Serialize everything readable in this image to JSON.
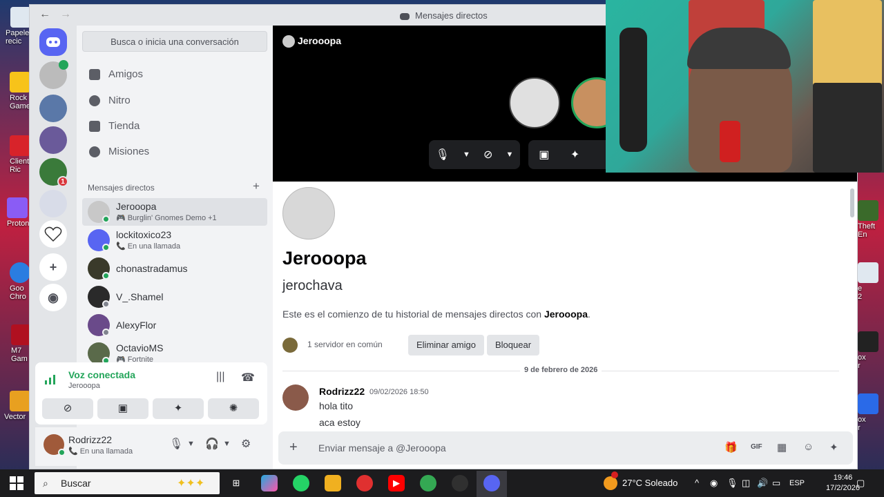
{
  "desktop": {
    "icons": [
      {
        "label": "Papele\nrecic",
        "color": "#dfe8f0"
      },
      {
        "label": "Rock\nGame",
        "color": "#f7c31a"
      },
      {
        "label": "Client\nRic",
        "color": "#d8232a"
      },
      {
        "label": "Proton",
        "color": "#8a5cf5"
      },
      {
        "label": "Goo\nChro",
        "color": "#2a7de1"
      },
      {
        "label": "M7\nGam",
        "color": "#b01020"
      },
      {
        "label": "Vector",
        "color": "#e8a020"
      }
    ],
    "right_icons": [
      "Theft\nEn",
      "e\n2",
      "ox\nr",
      "ox\nr"
    ]
  },
  "window": {
    "title": "Mensajes directos",
    "back": "←",
    "forward": "→"
  },
  "rail": {
    "badge": "1",
    "add_label": "+",
    "explore_label": "◉"
  },
  "sidebar": {
    "search_placeholder": "Busca o inicia una conversación",
    "nav": [
      {
        "label": "Amigos",
        "icon": "friends-icon"
      },
      {
        "label": "Nitro",
        "icon": "nitro-icon"
      },
      {
        "label": "Tienda",
        "icon": "shop-icon"
      },
      {
        "label": "Misiones",
        "icon": "quests-icon"
      }
    ],
    "dm_header": "Mensajes directos",
    "dm_add": "+",
    "dms": [
      {
        "name": "Jerooopa",
        "sub": "Burglin' Gnomes Demo +1",
        "sub_icon": "🎮",
        "color": "#c8c8c8"
      },
      {
        "name": "lockitoxico23",
        "sub": "En una llamada",
        "sub_icon": "📞",
        "color": "#5865f2"
      },
      {
        "name": "chonastradamus",
        "sub": "",
        "sub_icon": "",
        "color": "#3a3a2a"
      },
      {
        "name": "V_.Shamel",
        "sub": "",
        "sub_icon": "",
        "color": "#2a2a2a"
      },
      {
        "name": "AlexyFlor",
        "sub": "",
        "sub_icon": "",
        "color": "#6a4a8a"
      },
      {
        "name": "OctavioMS",
        "sub": "Fortnite",
        "sub_icon": "🎮",
        "color": "#5a6a4a"
      }
    ]
  },
  "voice": {
    "title": "Voz conectada",
    "channel": "Jerooopa",
    "buttons": [
      "camera-off",
      "screen-share",
      "activities",
      "soundboard"
    ]
  },
  "user": {
    "name": "Rodrizz22",
    "status": "En una llamada"
  },
  "call": {
    "name": "Jerooopa"
  },
  "chat": {
    "display_name": "Jerooopa",
    "username": "jerochava",
    "intro_prefix": "Este es el comienzo de tu historial de mensajes directos con ",
    "intro_name": "Jerooopa",
    "intro_suffix": ".",
    "common": "1 servidor en común",
    "remove_friend": "Eliminar amigo",
    "block": "Bloquear",
    "date": "9 de febrero de 2026",
    "message": {
      "author": "Rodrizz22",
      "time": "09/02/2026 18:50",
      "lines": [
        "hola tito",
        "aca estoy"
      ]
    },
    "composer_placeholder": "Enviar mensaje a @Jerooopa"
  },
  "taskbar": {
    "search": "Buscar",
    "weather": "27°C  Soleado",
    "lang": "ESP",
    "time": "19:46",
    "date": "17/2/2026"
  }
}
